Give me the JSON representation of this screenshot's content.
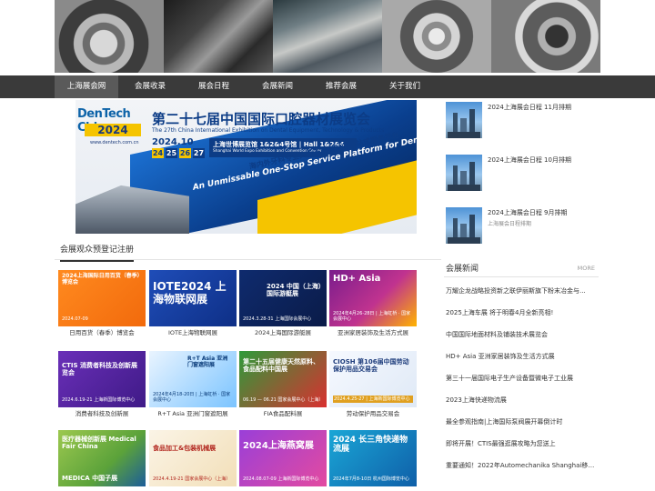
{
  "banner": {
    "tiles": [
      "car-interior-photo",
      "car-parts-photo",
      "engine-photo",
      "turbo-part-photo",
      "wheel-hub-photo"
    ]
  },
  "nav": {
    "items": [
      {
        "label": "上海展会网",
        "active": true
      },
      {
        "label": "会展收录",
        "active": false
      },
      {
        "label": "展会日程",
        "active": false
      },
      {
        "label": "会展新闻",
        "active": false
      },
      {
        "label": "推荐会展",
        "active": false
      },
      {
        "label": "关于我们",
        "active": false
      }
    ]
  },
  "hero": {
    "logo_line1": "DenTech China",
    "logo_line2": "2024",
    "logo_url": "www.dentech.com.cn",
    "title": "第二十七届中国国际口腔器材展览会",
    "subtitle": "The 27th China International Exhibition on Dental Equipment, Technology & Products",
    "date": "2024.10",
    "days": [
      "24",
      "25",
      "26",
      "27"
    ],
    "venue_cn": "上海世博展览馆 1&2&4号馆 | Hall 1&2&4",
    "venue_en": "Shanghai World Expo Exhibition and Convention Center",
    "slogan_cn": "海内外牙科专业人士不容错过的一站式服务平台",
    "slogan_en1": "An Unmissable One-Stop Service Platform for Dental Professionals",
    "slogan_en2": ""
  },
  "section": {
    "title": "会展观众预登记注册"
  },
  "expos": [
    {
      "label": "日用百货（春季）博览会",
      "thumb_title": "2024上海国际日用百货（春季）博览会",
      "thumb_sub": "2024.07-09",
      "style": "th1"
    },
    {
      "label": "IOTE上海物联网展",
      "thumb_title": "IOTE2024 上海物联网展",
      "thumb_sub": "",
      "style": "th2"
    },
    {
      "label": "2024上海国际游艇展",
      "thumb_title": "2024 中国（上海）国际游艇展",
      "thumb_sub": "2024.3.28-31 上海国际会展中心",
      "style": "th3"
    },
    {
      "label": "亚洲家居装饰及生活方式展",
      "thumb_title": "HD+ Asia",
      "thumb_sub": "2024年4月26-28日 | 上海虹桥 · 国家会展中心",
      "style": "th4"
    },
    {
      "label": "消费者科技及创新展",
      "thumb_title": "CTIS 消费者科技及创新展览会",
      "thumb_sub": "2024.6.19-21 上海新国际博览中心",
      "style": "th5"
    },
    {
      "label": "R+T Asia 亚洲门窗遮阳展",
      "thumb_title": "R+T Asia 亚洲门窗遮阳展",
      "thumb_sub": "2024年4月18-20日 | 上海虹桥 · 国家会展中心",
      "style": "th6"
    },
    {
      "label": "FIA食品配料展",
      "thumb_title": "第二十五届健康天然原料、食品配料中国展",
      "thumb_sub": "06.19 — 06.21 国家会展中心（上海）",
      "style": "th7"
    },
    {
      "label": "劳动保护用品交易会",
      "thumb_title": "CIOSH 第106届中国劳动保护用品交易会",
      "thumb_sub": "2024.4.25-27 | 上海新国际博览中心",
      "style": "th8"
    },
    {
      "label": "",
      "thumb_title": "医疗器械创新展 Medical Fair China",
      "thumb_sub": "MEDICA 中国子展",
      "style": "th9"
    },
    {
      "label": "",
      "thumb_title": "食品加工&包装机械展",
      "thumb_sub": "2024.4.19-21 国家会展中心（上海）",
      "style": "th10"
    },
    {
      "label": "",
      "thumb_title": "2024上海燕窝展",
      "thumb_sub": "2024.08.07-09 上海新国际博览中心",
      "style": "th11"
    },
    {
      "label": "",
      "thumb_title": "2024 长三角快递物流展",
      "thumb_sub": "2024年7月8-10日 杭州国际博览中心",
      "style": "th12"
    }
  ],
  "schedules": [
    {
      "title": "2024上海展会日程 11月排期",
      "sub": ""
    },
    {
      "title": "2024上海展会日程 10月排期",
      "sub": ""
    },
    {
      "title": "2024上海展会日程 9月排期",
      "sub": "上海展会日程排期"
    }
  ],
  "news": {
    "title": "会展新闻",
    "more": "MORE",
    "items": [
      "万耀企龙战略投资新之联伊丽斯旗下粉末冶金与...",
      "2025上海车展 将于明春4月全新亮相!",
      "中国国际地面材料及铺装技术展览会",
      "HD+ Asia 亚洲家居装饰及生活方式展",
      "第三十一届国际电子生产设备暨微电子工业展",
      "2023上海快递物流展",
      "最全参观指南|上海国际泵阀展开幕倒计时",
      "即将开展！CTIS最强逛展攻略为您送上",
      "重要通知！2022年Automechanika Shanghai移师..."
    ]
  }
}
